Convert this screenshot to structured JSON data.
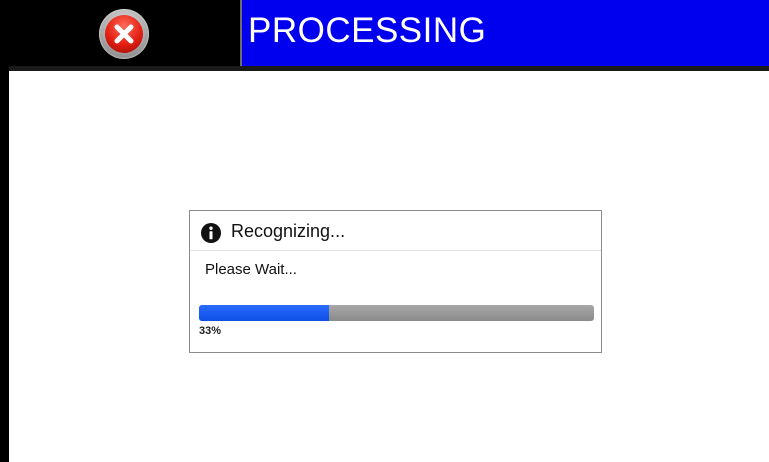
{
  "header": {
    "title": "PROCESSING",
    "close_icon": "close-icon",
    "title_bg": "#0000ee"
  },
  "dialog": {
    "icon": "info-icon",
    "title": "Recognizing...",
    "message": "Please Wait...",
    "progress": {
      "value": 33,
      "label": "33%",
      "fill_color": "#1f5ff5"
    }
  }
}
